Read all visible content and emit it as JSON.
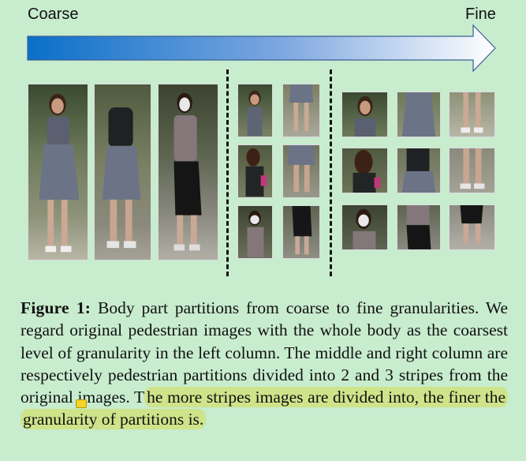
{
  "header": {
    "coarse_label": "Coarse",
    "fine_label": "Fine",
    "arrow_gradient": [
      "#0a6fc9",
      "#ffffff"
    ]
  },
  "columns": [
    {
      "name": "whole-body",
      "stripes": 1,
      "images": 3
    },
    {
      "name": "two-stripes",
      "stripes": 2,
      "images": 6
    },
    {
      "name": "three-stripes",
      "stripes": 3,
      "images": 9
    }
  ],
  "caption": {
    "label": "Figure 1:",
    "plain": " Body part partitions from coarse to fine granularities. We regard original pedestrian images with the whole body as the coarsest level of granularity in the left column. The middle and right column are respectively pedestrian partitions divided into 2 and 3 stripes from the original images. T",
    "highlighted": "he more stripes images are divided into, the finer the granularity of partitions is."
  },
  "colors": {
    "background": "#c8ecce",
    "highlight": "#cfe38a"
  }
}
